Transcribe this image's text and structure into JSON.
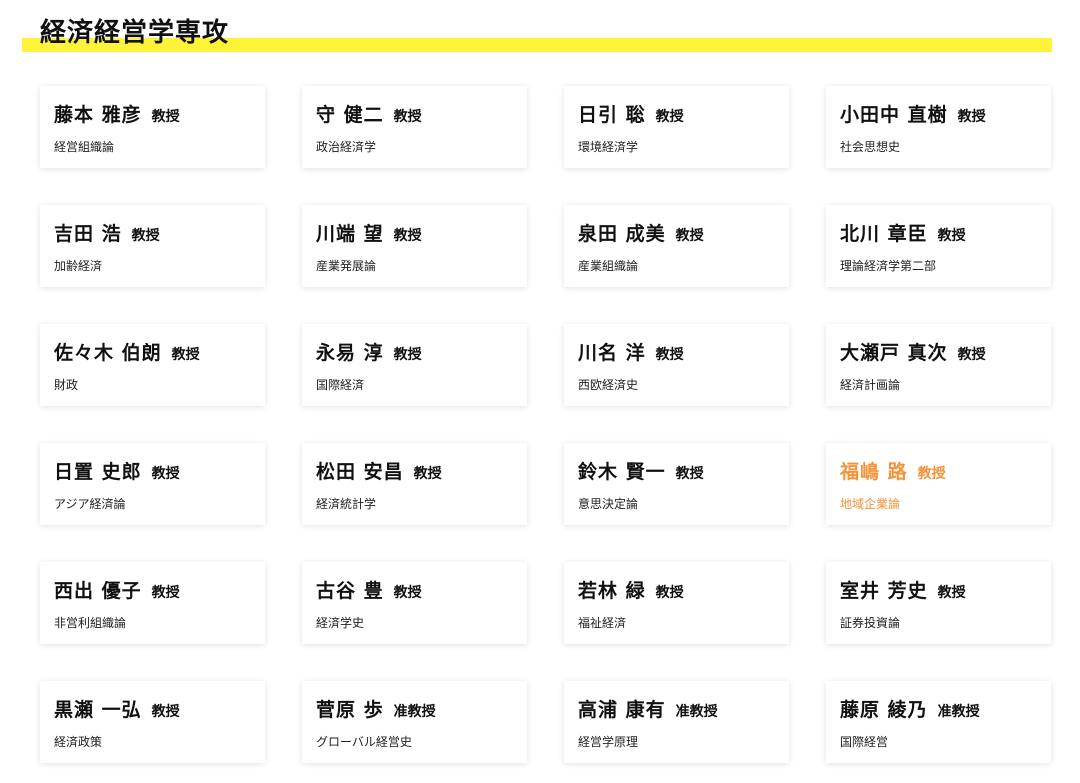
{
  "section": {
    "title": "経済経営学専攻",
    "accent_color": "#fff33a",
    "highlight_color": "#f7923a"
  },
  "faculty": [
    {
      "name": "藤本 雅彦",
      "title": "教授",
      "field": "経営組織論"
    },
    {
      "name": "守 健二",
      "title": "教授",
      "field": "政治経済学"
    },
    {
      "name": "日引 聡",
      "title": "教授",
      "field": "環境経済学"
    },
    {
      "name": "小田中 直樹",
      "title": "教授",
      "field": "社会思想史"
    },
    {
      "name": "吉田 浩",
      "title": "教授",
      "field": "加齢経済"
    },
    {
      "name": "川端 望",
      "title": "教授",
      "field": "産業発展論"
    },
    {
      "name": "泉田 成美",
      "title": "教授",
      "field": "産業組織論"
    },
    {
      "name": "北川 章臣",
      "title": "教授",
      "field": "理論経済学第二部"
    },
    {
      "name": "佐々木 伯朗",
      "title": "教授",
      "field": "財政"
    },
    {
      "name": "永易 淳",
      "title": "教授",
      "field": "国際経済"
    },
    {
      "name": "川名 洋",
      "title": "教授",
      "field": "西欧経済史"
    },
    {
      "name": "大瀬戸 真次",
      "title": "教授",
      "field": "経済計画論"
    },
    {
      "name": "日置 史郎",
      "title": "教授",
      "field": "アジア経済論"
    },
    {
      "name": "松田 安昌",
      "title": "教授",
      "field": "経済統計学"
    },
    {
      "name": "鈴木 賢一",
      "title": "教授",
      "field": "意思決定論"
    },
    {
      "name": "福嶋 路",
      "title": "教授",
      "field": "地域企業論",
      "highlighted": true
    },
    {
      "name": "西出 優子",
      "title": "教授",
      "field": "非営利組織論"
    },
    {
      "name": "古谷 豊",
      "title": "教授",
      "field": "経済学史"
    },
    {
      "name": "若林 緑",
      "title": "教授",
      "field": "福祉経済"
    },
    {
      "name": "室井 芳史",
      "title": "教授",
      "field": "証券投資論"
    },
    {
      "name": "黒瀬 一弘",
      "title": "教授",
      "field": "経済政策"
    },
    {
      "name": "菅原 歩",
      "title": "准教授",
      "field": "グローバル経営史"
    },
    {
      "name": "高浦 康有",
      "title": "准教授",
      "field": "経営学原理"
    },
    {
      "name": "藤原 綾乃",
      "title": "准教授",
      "field": "国際経営"
    }
  ]
}
